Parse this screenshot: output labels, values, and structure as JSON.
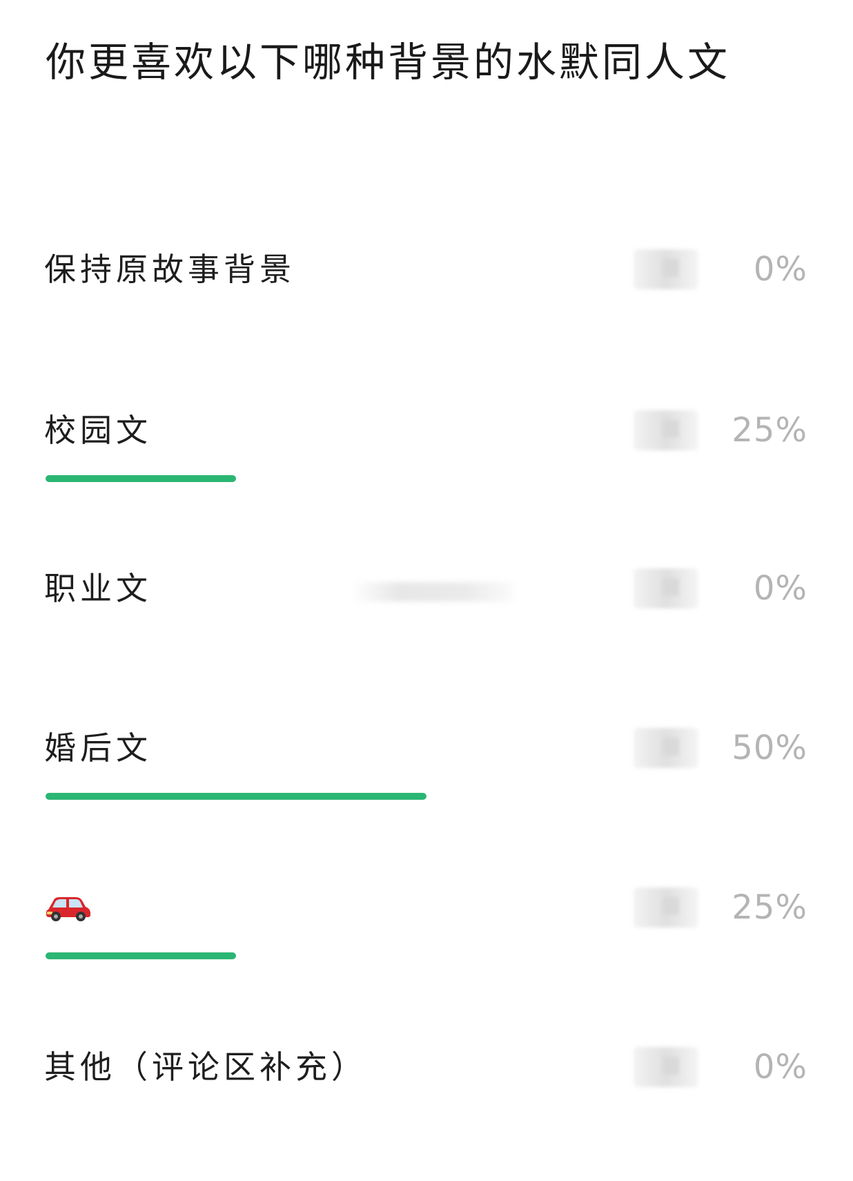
{
  "poll": {
    "question": "你更喜欢以下哪种背景的水默同人文",
    "accent_color": "#2bb673",
    "percent_color": "#b4b4b4",
    "options": [
      {
        "label": "保持原故事背景",
        "percent_text": "0%",
        "percent": 0,
        "icon": ""
      },
      {
        "label": "校园文",
        "percent_text": "25%",
        "percent": 25,
        "icon": ""
      },
      {
        "label": "职业文",
        "percent_text": "0%",
        "percent": 0,
        "icon": ""
      },
      {
        "label": "婚后文",
        "percent_text": "50%",
        "percent": 50,
        "icon": ""
      },
      {
        "label": "",
        "percent_text": "25%",
        "percent": 25,
        "icon": "red-car-icon"
      },
      {
        "label": "其他（评论区补充）",
        "percent_text": "0%",
        "percent": 0,
        "icon": ""
      }
    ]
  }
}
